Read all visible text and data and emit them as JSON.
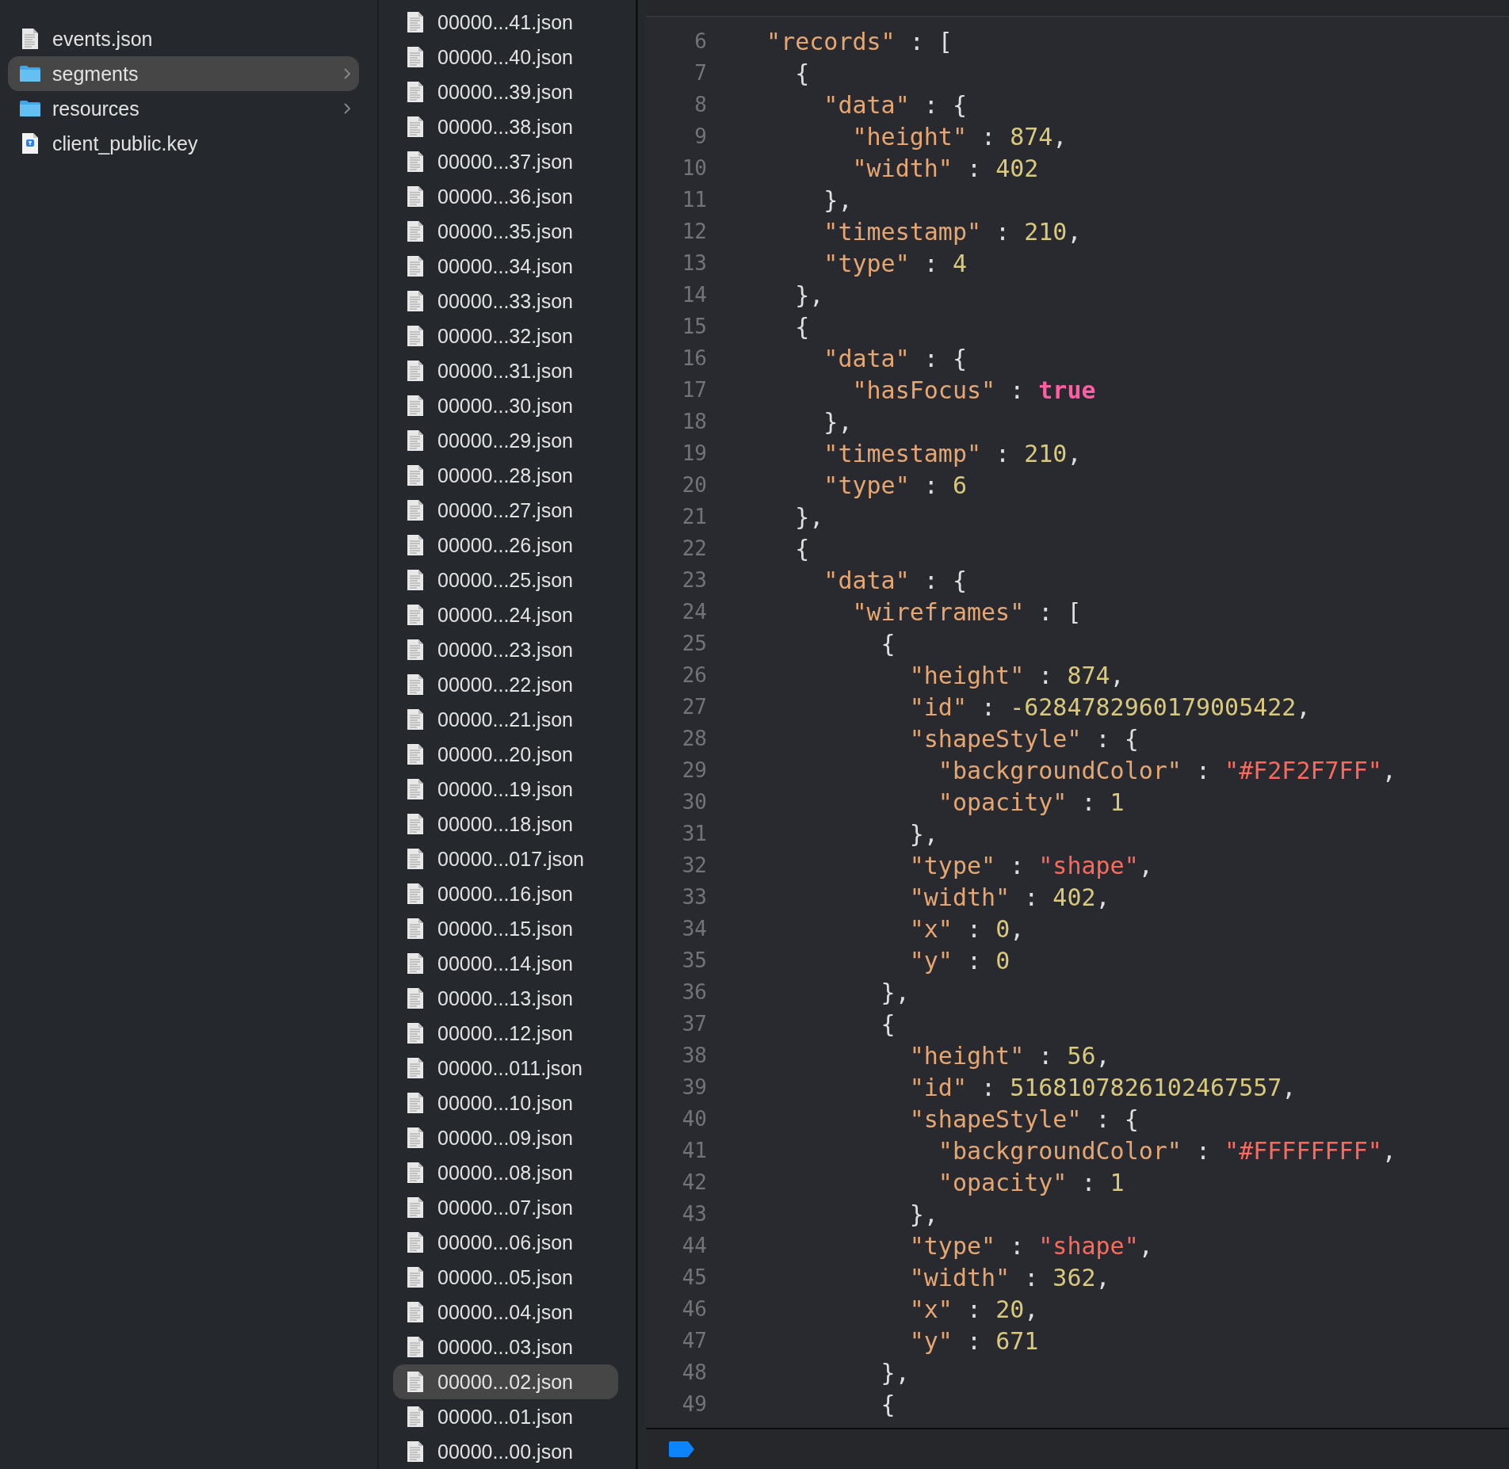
{
  "sidebar": {
    "items": [
      {
        "name": "events.json",
        "kind": "document",
        "selected": false
      },
      {
        "name": "segments",
        "kind": "folder",
        "selected": true
      },
      {
        "name": "resources",
        "kind": "folder",
        "selected": false
      },
      {
        "name": "client_public.key",
        "kind": "key",
        "selected": false
      }
    ]
  },
  "files": {
    "items": [
      {
        "name": "00000...41.json",
        "selected": false
      },
      {
        "name": "00000...40.json",
        "selected": false
      },
      {
        "name": "00000...39.json",
        "selected": false
      },
      {
        "name": "00000...38.json",
        "selected": false
      },
      {
        "name": "00000...37.json",
        "selected": false
      },
      {
        "name": "00000...36.json",
        "selected": false
      },
      {
        "name": "00000...35.json",
        "selected": false
      },
      {
        "name": "00000...34.json",
        "selected": false
      },
      {
        "name": "00000...33.json",
        "selected": false
      },
      {
        "name": "00000...32.json",
        "selected": false
      },
      {
        "name": "00000...31.json",
        "selected": false
      },
      {
        "name": "00000...30.json",
        "selected": false
      },
      {
        "name": "00000...29.json",
        "selected": false
      },
      {
        "name": "00000...28.json",
        "selected": false
      },
      {
        "name": "00000...27.json",
        "selected": false
      },
      {
        "name": "00000...26.json",
        "selected": false
      },
      {
        "name": "00000...25.json",
        "selected": false
      },
      {
        "name": "00000...24.json",
        "selected": false
      },
      {
        "name": "00000...23.json",
        "selected": false
      },
      {
        "name": "00000...22.json",
        "selected": false
      },
      {
        "name": "00000...21.json",
        "selected": false
      },
      {
        "name": "00000...20.json",
        "selected": false
      },
      {
        "name": "00000...19.json",
        "selected": false
      },
      {
        "name": "00000...18.json",
        "selected": false
      },
      {
        "name": "00000...017.json",
        "selected": false
      },
      {
        "name": "00000...16.json",
        "selected": false
      },
      {
        "name": "00000...15.json",
        "selected": false
      },
      {
        "name": "00000...14.json",
        "selected": false
      },
      {
        "name": "00000...13.json",
        "selected": false
      },
      {
        "name": "00000...12.json",
        "selected": false
      },
      {
        "name": "00000...011.json",
        "selected": false
      },
      {
        "name": "00000...10.json",
        "selected": false
      },
      {
        "name": "00000...09.json",
        "selected": false
      },
      {
        "name": "00000...08.json",
        "selected": false
      },
      {
        "name": "00000...07.json",
        "selected": false
      },
      {
        "name": "00000...06.json",
        "selected": false
      },
      {
        "name": "00000...05.json",
        "selected": false
      },
      {
        "name": "00000...04.json",
        "selected": false
      },
      {
        "name": "00000...03.json",
        "selected": false
      },
      {
        "name": "00000...02.json",
        "selected": true
      },
      {
        "name": "00000...01.json",
        "selected": false
      },
      {
        "name": "00000...00.json",
        "selected": false
      }
    ]
  },
  "editor": {
    "lines": [
      {
        "number": "6",
        "tokens": [
          {
            "kind": "key",
            "text": "  \"records\""
          },
          {
            "kind": "plain",
            "text": " : ["
          }
        ]
      },
      {
        "number": "7",
        "tokens": [
          {
            "kind": "plain",
            "text": "    {"
          }
        ]
      },
      {
        "number": "8",
        "tokens": [
          {
            "kind": "key",
            "text": "      \"data\""
          },
          {
            "kind": "plain",
            "text": " : {"
          }
        ]
      },
      {
        "number": "9",
        "tokens": [
          {
            "kind": "key",
            "text": "        \"height\""
          },
          {
            "kind": "plain",
            "text": " : "
          },
          {
            "kind": "number",
            "text": "874"
          },
          {
            "kind": "plain",
            "text": ","
          }
        ]
      },
      {
        "number": "10",
        "tokens": [
          {
            "kind": "key",
            "text": "        \"width\""
          },
          {
            "kind": "plain",
            "text": " : "
          },
          {
            "kind": "number",
            "text": "402"
          }
        ]
      },
      {
        "number": "11",
        "tokens": [
          {
            "kind": "plain",
            "text": "      },"
          }
        ]
      },
      {
        "number": "12",
        "tokens": [
          {
            "kind": "key",
            "text": "      \"timestamp\""
          },
          {
            "kind": "plain",
            "text": " : "
          },
          {
            "kind": "number",
            "text": "210"
          },
          {
            "kind": "plain",
            "text": ","
          }
        ]
      },
      {
        "number": "13",
        "tokens": [
          {
            "kind": "key",
            "text": "      \"type\""
          },
          {
            "kind": "plain",
            "text": " : "
          },
          {
            "kind": "number",
            "text": "4"
          }
        ]
      },
      {
        "number": "14",
        "tokens": [
          {
            "kind": "plain",
            "text": "    },"
          }
        ]
      },
      {
        "number": "15",
        "tokens": [
          {
            "kind": "plain",
            "text": "    {"
          }
        ]
      },
      {
        "number": "16",
        "tokens": [
          {
            "kind": "key",
            "text": "      \"data\""
          },
          {
            "kind": "plain",
            "text": " : {"
          }
        ]
      },
      {
        "number": "17",
        "tokens": [
          {
            "kind": "key",
            "text": "        \"hasFocus\""
          },
          {
            "kind": "plain",
            "text": " : "
          },
          {
            "kind": "keyword",
            "text": "true"
          }
        ]
      },
      {
        "number": "18",
        "tokens": [
          {
            "kind": "plain",
            "text": "      },"
          }
        ]
      },
      {
        "number": "19",
        "tokens": [
          {
            "kind": "key",
            "text": "      \"timestamp\""
          },
          {
            "kind": "plain",
            "text": " : "
          },
          {
            "kind": "number",
            "text": "210"
          },
          {
            "kind": "plain",
            "text": ","
          }
        ]
      },
      {
        "number": "20",
        "tokens": [
          {
            "kind": "key",
            "text": "      \"type\""
          },
          {
            "kind": "plain",
            "text": " : "
          },
          {
            "kind": "number",
            "text": "6"
          }
        ]
      },
      {
        "number": "21",
        "tokens": [
          {
            "kind": "plain",
            "text": "    },"
          }
        ]
      },
      {
        "number": "22",
        "tokens": [
          {
            "kind": "plain",
            "text": "    {"
          }
        ]
      },
      {
        "number": "23",
        "tokens": [
          {
            "kind": "key",
            "text": "      \"data\""
          },
          {
            "kind": "plain",
            "text": " : {"
          }
        ]
      },
      {
        "number": "24",
        "tokens": [
          {
            "kind": "key",
            "text": "        \"wireframes\""
          },
          {
            "kind": "plain",
            "text": " : ["
          }
        ]
      },
      {
        "number": "25",
        "tokens": [
          {
            "kind": "plain",
            "text": "          {"
          }
        ]
      },
      {
        "number": "26",
        "tokens": [
          {
            "kind": "key",
            "text": "            \"height\""
          },
          {
            "kind": "plain",
            "text": " : "
          },
          {
            "kind": "number",
            "text": "874"
          },
          {
            "kind": "plain",
            "text": ","
          }
        ]
      },
      {
        "number": "27",
        "tokens": [
          {
            "kind": "key",
            "text": "            \"id\""
          },
          {
            "kind": "plain",
            "text": " : "
          },
          {
            "kind": "number",
            "text": "-6284782960179005422"
          },
          {
            "kind": "plain",
            "text": ","
          }
        ]
      },
      {
        "number": "28",
        "tokens": [
          {
            "kind": "key",
            "text": "            \"shapeStyle\""
          },
          {
            "kind": "plain",
            "text": " : {"
          }
        ]
      },
      {
        "number": "29",
        "tokens": [
          {
            "kind": "key",
            "text": "              \"backgroundColor\""
          },
          {
            "kind": "plain",
            "text": " : "
          },
          {
            "kind": "string",
            "text": "\"#F2F2F7FF\""
          },
          {
            "kind": "plain",
            "text": ","
          }
        ]
      },
      {
        "number": "30",
        "tokens": [
          {
            "kind": "key",
            "text": "              \"opacity\""
          },
          {
            "kind": "plain",
            "text": " : "
          },
          {
            "kind": "number",
            "text": "1"
          }
        ]
      },
      {
        "number": "31",
        "tokens": [
          {
            "kind": "plain",
            "text": "            },"
          }
        ]
      },
      {
        "number": "32",
        "tokens": [
          {
            "kind": "key",
            "text": "            \"type\""
          },
          {
            "kind": "plain",
            "text": " : "
          },
          {
            "kind": "string",
            "text": "\"shape\""
          },
          {
            "kind": "plain",
            "text": ","
          }
        ]
      },
      {
        "number": "33",
        "tokens": [
          {
            "kind": "key",
            "text": "            \"width\""
          },
          {
            "kind": "plain",
            "text": " : "
          },
          {
            "kind": "number",
            "text": "402"
          },
          {
            "kind": "plain",
            "text": ","
          }
        ]
      },
      {
        "number": "34",
        "tokens": [
          {
            "kind": "key",
            "text": "            \"x\""
          },
          {
            "kind": "plain",
            "text": " : "
          },
          {
            "kind": "number",
            "text": "0"
          },
          {
            "kind": "plain",
            "text": ","
          }
        ]
      },
      {
        "number": "35",
        "tokens": [
          {
            "kind": "key",
            "text": "            \"y\""
          },
          {
            "kind": "plain",
            "text": " : "
          },
          {
            "kind": "number",
            "text": "0"
          }
        ]
      },
      {
        "number": "36",
        "tokens": [
          {
            "kind": "plain",
            "text": "          },"
          }
        ]
      },
      {
        "number": "37",
        "tokens": [
          {
            "kind": "plain",
            "text": "          {"
          }
        ]
      },
      {
        "number": "38",
        "tokens": [
          {
            "kind": "key",
            "text": "            \"height\""
          },
          {
            "kind": "plain",
            "text": " : "
          },
          {
            "kind": "number",
            "text": "56"
          },
          {
            "kind": "plain",
            "text": ","
          }
        ]
      },
      {
        "number": "39",
        "tokens": [
          {
            "kind": "key",
            "text": "            \"id\""
          },
          {
            "kind": "plain",
            "text": " : "
          },
          {
            "kind": "number",
            "text": "5168107826102467557"
          },
          {
            "kind": "plain",
            "text": ","
          }
        ]
      },
      {
        "number": "40",
        "tokens": [
          {
            "kind": "key",
            "text": "            \"shapeStyle\""
          },
          {
            "kind": "plain",
            "text": " : {"
          }
        ]
      },
      {
        "number": "41",
        "tokens": [
          {
            "kind": "key",
            "text": "              \"backgroundColor\""
          },
          {
            "kind": "plain",
            "text": " : "
          },
          {
            "kind": "string",
            "text": "\"#FFFFFFFF\""
          },
          {
            "kind": "plain",
            "text": ","
          }
        ]
      },
      {
        "number": "42",
        "tokens": [
          {
            "kind": "key",
            "text": "              \"opacity\""
          },
          {
            "kind": "plain",
            "text": " : "
          },
          {
            "kind": "number",
            "text": "1"
          }
        ]
      },
      {
        "number": "43",
        "tokens": [
          {
            "kind": "plain",
            "text": "            },"
          }
        ]
      },
      {
        "number": "44",
        "tokens": [
          {
            "kind": "key",
            "text": "            \"type\""
          },
          {
            "kind": "plain",
            "text": " : "
          },
          {
            "kind": "string",
            "text": "\"shape\""
          },
          {
            "kind": "plain",
            "text": ","
          }
        ]
      },
      {
        "number": "45",
        "tokens": [
          {
            "kind": "key",
            "text": "            \"width\""
          },
          {
            "kind": "plain",
            "text": " : "
          },
          {
            "kind": "number",
            "text": "362"
          },
          {
            "kind": "plain",
            "text": ","
          }
        ]
      },
      {
        "number": "46",
        "tokens": [
          {
            "kind": "key",
            "text": "            \"x\""
          },
          {
            "kind": "plain",
            "text": " : "
          },
          {
            "kind": "number",
            "text": "20"
          },
          {
            "kind": "plain",
            "text": ","
          }
        ]
      },
      {
        "number": "47",
        "tokens": [
          {
            "kind": "key",
            "text": "            \"y\""
          },
          {
            "kind": "plain",
            "text": " : "
          },
          {
            "kind": "number",
            "text": "671"
          }
        ]
      },
      {
        "number": "48",
        "tokens": [
          {
            "kind": "plain",
            "text": "          },"
          }
        ]
      },
      {
        "number": "49",
        "tokens": [
          {
            "kind": "plain",
            "text": "          {"
          }
        ]
      }
    ]
  }
}
